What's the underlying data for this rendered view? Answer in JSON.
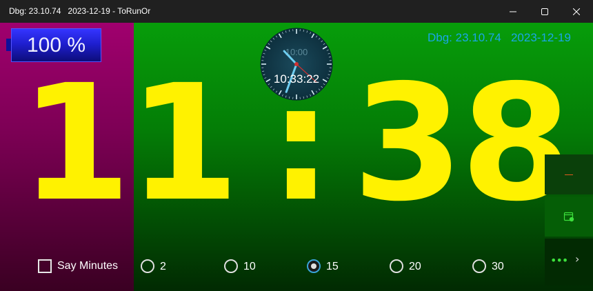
{
  "window": {
    "title": "Dbg: 23.10.74   2023-12-19 - ToRunOr"
  },
  "battery": {
    "label": "100 %"
  },
  "dbg_info": "Dbg: 23.10.74   2023-12-19",
  "big_clock": {
    "digit_1": "1",
    "digit_2": "1",
    "separator": ":",
    "digit_3": "3",
    "digit_4": "8"
  },
  "analog_clock": {
    "faint_time": "10:00",
    "digital_time": "10:33:22",
    "hour": 10,
    "minute": 33,
    "second": 22
  },
  "options": {
    "say_minutes_label": "Say Minutes",
    "say_minutes_checked": false,
    "intervals": [
      {
        "label": "2",
        "checked": false
      },
      {
        "label": "10",
        "checked": false
      },
      {
        "label": "15",
        "checked": true
      },
      {
        "label": "20",
        "checked": false
      },
      {
        "label": "30",
        "checked": false
      }
    ]
  },
  "colors": {
    "digit": "#fff200",
    "left_panel": "#a0006e",
    "main_panel": "#079d0a",
    "accent": "#1aa6e8",
    "battery": "#2a2aee"
  },
  "icons": [
    "minimize-icon",
    "maximize-icon",
    "close-icon",
    "minus-icon",
    "calendar-icon",
    "more-dots-icon",
    "chevron-right-icon"
  ]
}
